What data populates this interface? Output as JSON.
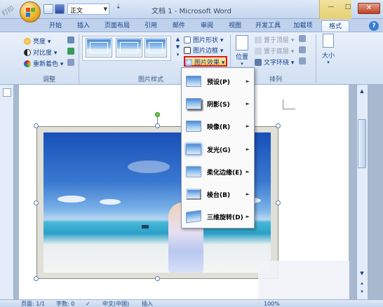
{
  "window": {
    "title": "文档 1 - Microsoft Word",
    "close_glyph": "✕",
    "min_glyph": "—",
    "max_glyph": "□"
  },
  "qat": {
    "style_value": "正文",
    "more_glyph": "⇣"
  },
  "tabs": [
    "开始",
    "插入",
    "页面布局",
    "引用",
    "邮件",
    "审阅",
    "视图",
    "开发工具",
    "加载项",
    "格式"
  ],
  "active_tab": "格式",
  "help_glyph": "?",
  "ribbon": {
    "adjust": {
      "label": "调整",
      "brightness": "亮度 ▾",
      "contrast": "对比度 ▾",
      "recolor": "重新着色 ▾"
    },
    "styles": {
      "label": "图片样式",
      "shape": "图片形状 ▾",
      "border": "图片边框 ▾",
      "effects": "图片效果 ▾"
    },
    "arrange": {
      "label": "排列",
      "position": "位置",
      "bring_front": "置于顶层 ▾",
      "send_back": "置于底层 ▾",
      "text_wrap": "文字环绕 ▾"
    },
    "size": {
      "label": "大小"
    }
  },
  "menu": [
    {
      "label": "预设(P)"
    },
    {
      "label": "阴影(S)"
    },
    {
      "label": "映像(R)"
    },
    {
      "label": "发光(G)"
    },
    {
      "label": "柔化边缘(E)"
    },
    {
      "label": "棱台(B)"
    },
    {
      "label": "三维旋转(D)"
    }
  ],
  "statusbar": {
    "page": "页面: 1/1",
    "words": "字数: 0",
    "lang": "中文(中国)",
    "mode": "插入",
    "zoom": "100%"
  },
  "watermark": "打印"
}
